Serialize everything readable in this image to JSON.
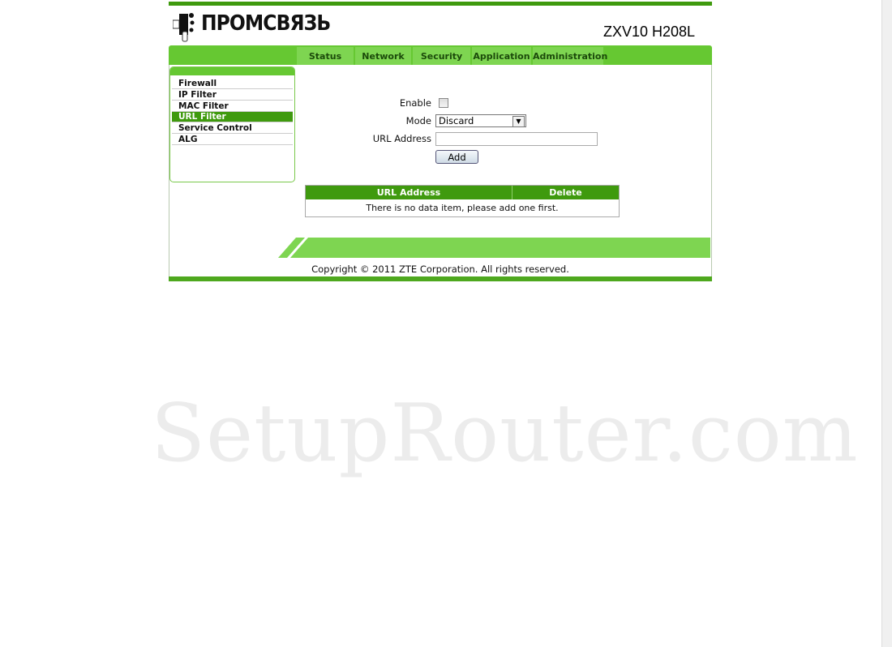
{
  "brand": {
    "logo_text": "ПРОМСВЯЗЬ",
    "model": "ZXV10 H208L"
  },
  "nav": {
    "tabs": [
      {
        "label": "Status"
      },
      {
        "label": "Network"
      },
      {
        "label": "Security"
      },
      {
        "label": "Application"
      },
      {
        "label": "Administration"
      }
    ],
    "active": "Security"
  },
  "sidebar": {
    "items": [
      {
        "label": "Firewall"
      },
      {
        "label": "IP Filter"
      },
      {
        "label": "MAC Filter"
      },
      {
        "label": "URL Filter",
        "selected": true
      },
      {
        "label": "Service Control"
      },
      {
        "label": "ALG"
      }
    ]
  },
  "form": {
    "enable_label": "Enable",
    "enable_checked": false,
    "mode_label": "Mode",
    "mode_value": "Discard",
    "url_label": "URL Address",
    "url_value": "",
    "add_label": "Add"
  },
  "table": {
    "headers": [
      "URL Address",
      "Delete"
    ],
    "empty_message": "There is no data item, please add one first."
  },
  "footer": {
    "copyright": "Copyright © 2011 ZTE Corporation. All rights reserved."
  },
  "watermark": "SetupRouter.com",
  "colors": {
    "dark_green": "#3f9a0e",
    "green": "#66c832",
    "light_green": "#7ed551"
  }
}
